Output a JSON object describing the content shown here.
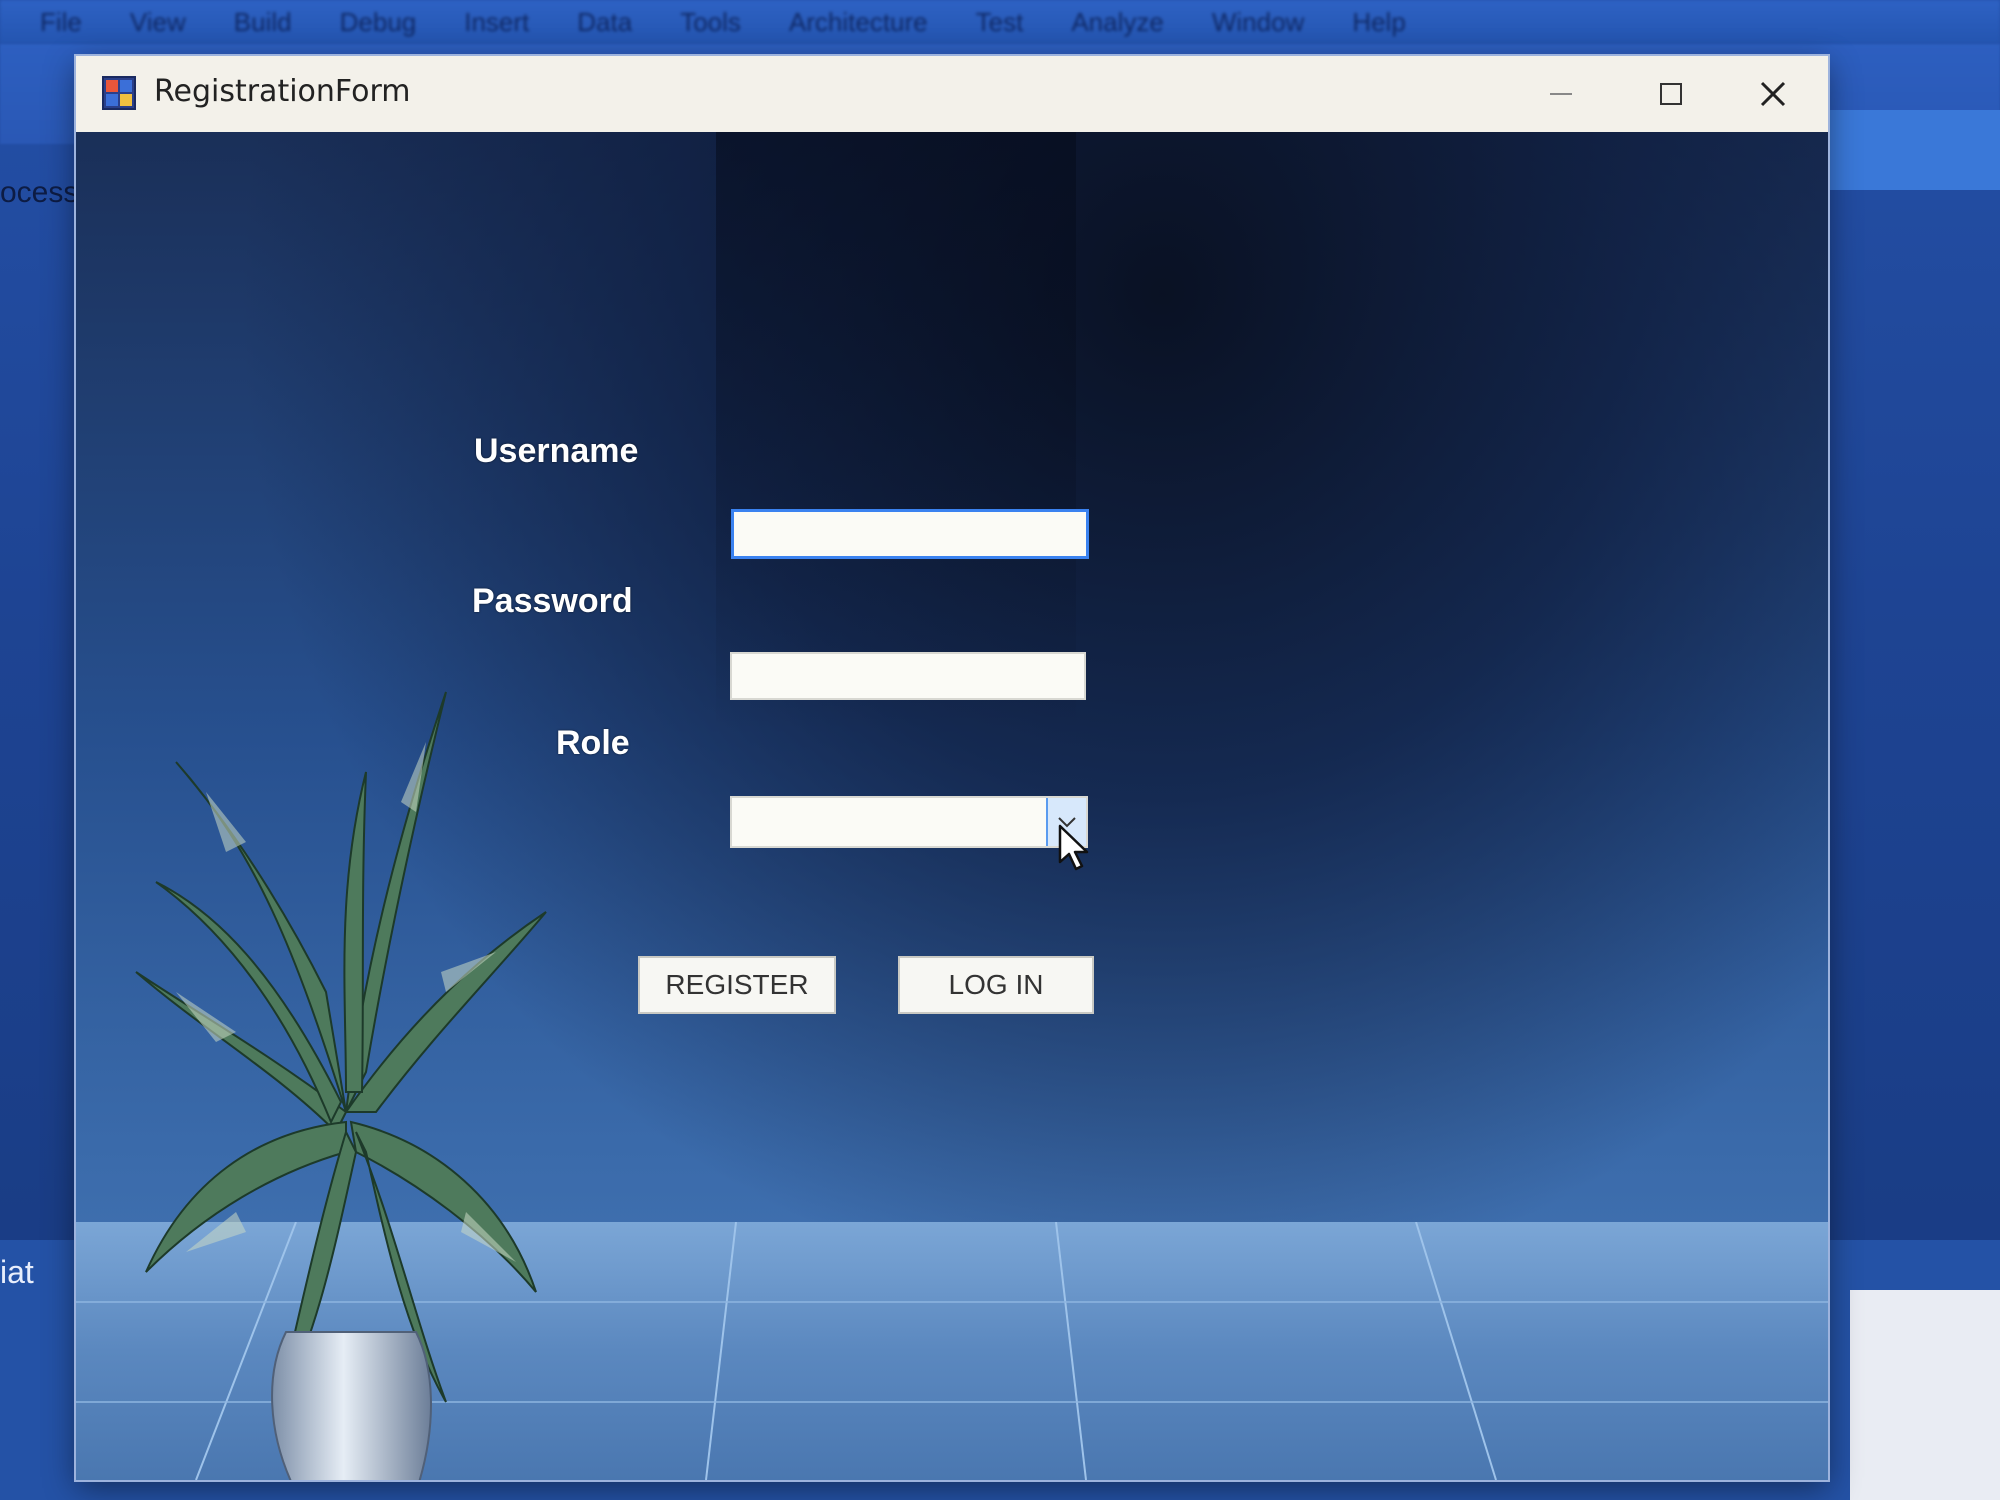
{
  "ide": {
    "menu": [
      "File",
      "View",
      "Build",
      "Debug",
      "Insert",
      "Data",
      "Tools",
      "Architecture",
      "Test",
      "Analyze",
      "Window",
      "Help"
    ],
    "side_label": "ocess",
    "bottom_label": "iat"
  },
  "window": {
    "title": "RegistrationForm",
    "icon": "app-icon",
    "controls": {
      "minimize": "minimize-icon",
      "maximize": "maximize-icon",
      "close": "close-icon"
    }
  },
  "form": {
    "username": {
      "label": "Username",
      "value": "",
      "placeholder": ""
    },
    "password": {
      "label": "Password",
      "value": "",
      "placeholder": ""
    },
    "role": {
      "label": "Role",
      "value": "",
      "dropdown_icon": "chevron-down-icon"
    },
    "buttons": {
      "register": "REGISTER",
      "login": "LOG IN"
    }
  },
  "colors": {
    "focus_border": "#3a82f0",
    "dropdown_highlight": "#d7e8fb",
    "background_blue": "#27508f"
  }
}
